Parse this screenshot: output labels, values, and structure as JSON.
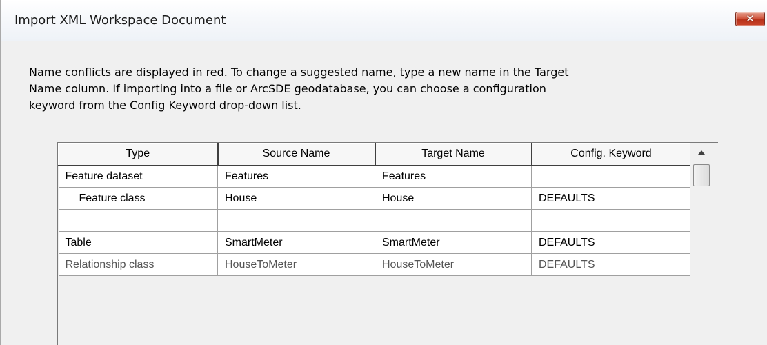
{
  "window": {
    "title": "Import XML Workspace Document",
    "close_label": "✕"
  },
  "instructions": "Name conflicts are displayed in red. To change a suggested name, type a new name in the Target Name column. If importing into a file or ArcSDE geodatabase, you can choose a configuration keyword from the Config Keyword drop-down list.",
  "grid": {
    "headers": [
      "Type",
      "Source Name",
      "Target Name",
      "Config. Keyword"
    ],
    "rows": [
      [
        "Feature dataset",
        "Features",
        "Features",
        ""
      ],
      [
        "Feature class",
        "House",
        "House",
        "DEFAULTS"
      ],
      [
        "",
        "",
        "",
        ""
      ],
      [
        "Table",
        "SmartMeter",
        "SmartMeter",
        "DEFAULTS"
      ],
      [
        "Relationship class",
        "HouseToMeter",
        "HouseToMeter",
        "DEFAULTS"
      ]
    ]
  },
  "icons": {
    "close": "close-icon",
    "scroll_up": "scroll-up-arrow-icon"
  },
  "colors": {
    "close_button": "#c9442a",
    "conflict": "#ff0000"
  }
}
